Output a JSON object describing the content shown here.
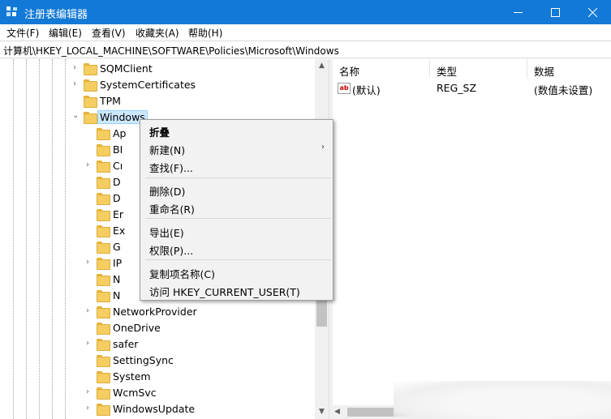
{
  "window": {
    "title": "注册表编辑器",
    "accent": "#1379d6",
    "minimize_icon": "minimize-icon",
    "maximize_icon": "maximize-icon",
    "close_icon": "close-icon"
  },
  "menubar": {
    "items": [
      "文件(F)",
      "编辑(E)",
      "查看(V)",
      "收藏夹(A)",
      "帮助(H)"
    ]
  },
  "address": {
    "path": "计算机\\HKEY_LOCAL_MACHINE\\SOFTWARE\\Policies\\Microsoft\\Windows"
  },
  "tree": {
    "items": [
      {
        "label": "SQMClient",
        "expandable": true
      },
      {
        "label": "SystemCertificates",
        "expandable": true
      },
      {
        "label": "TPM",
        "expandable": false
      },
      {
        "label": "Windows",
        "expandable": true,
        "expanded": true,
        "selected": true
      },
      {
        "label": "Ap",
        "expandable": false
      },
      {
        "label": "BI",
        "expandable": false
      },
      {
        "label": "Cı",
        "expandable": true
      },
      {
        "label": "D",
        "expandable": false
      },
      {
        "label": "D",
        "expandable": false
      },
      {
        "label": "Er",
        "expandable": false
      },
      {
        "label": "Ex",
        "expandable": false
      },
      {
        "label": "G",
        "expandable": false
      },
      {
        "label": "IP",
        "expandable": true
      },
      {
        "label": "N",
        "expandable": false
      },
      {
        "label": "N",
        "expandable": false
      },
      {
        "label": "NetworkProvider",
        "expandable": true
      },
      {
        "label": "OneDrive",
        "expandable": false
      },
      {
        "label": "safer",
        "expandable": true
      },
      {
        "label": "SettingSync",
        "expandable": false
      },
      {
        "label": "System",
        "expandable": false
      },
      {
        "label": "WcmSvc",
        "expandable": true
      },
      {
        "label": "WindowsUpdate",
        "expandable": true
      }
    ]
  },
  "values": {
    "columns": [
      "名称",
      "类型",
      "数据"
    ],
    "rows": [
      {
        "name": "(默认)",
        "type": "REG_SZ",
        "data": "(数值未设置)",
        "icon": "string-value-icon"
      }
    ]
  },
  "context_menu": {
    "items": [
      {
        "label": "折叠",
        "bold": true
      },
      {
        "label": "新建(N)",
        "submenu": true
      },
      {
        "label": "查找(F)..."
      },
      {
        "label": "删除(D)"
      },
      {
        "label": "重命名(R)"
      },
      {
        "label": "导出(E)"
      },
      {
        "label": "权限(P)..."
      },
      {
        "label": "复制项名称(C)"
      },
      {
        "label": "访问 HKEY_CURRENT_USER(T)"
      }
    ]
  }
}
